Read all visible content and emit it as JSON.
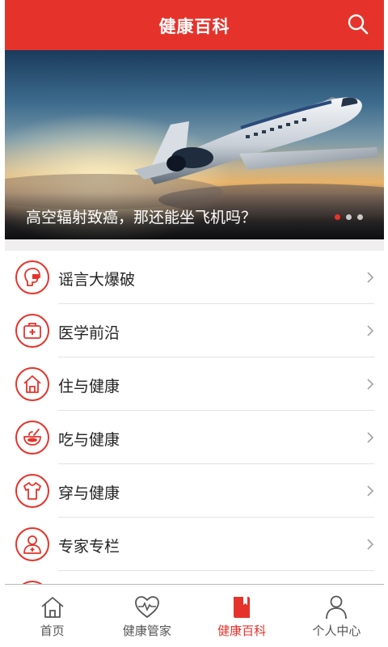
{
  "header": {
    "title": "健康百科",
    "search_icon": "search-icon"
  },
  "banner": {
    "caption": "高空辐射致癌，那还能坐飞机吗？",
    "slide_count": 3,
    "active_slide": 1
  },
  "categories": [
    {
      "label": "谣言大爆破",
      "icon": "rumor-speaker-icon"
    },
    {
      "label": "医学前沿",
      "icon": "medical-kit-icon"
    },
    {
      "label": "住与健康",
      "icon": "house-icon"
    },
    {
      "label": "吃与健康",
      "icon": "bowl-icon"
    },
    {
      "label": "穿与健康",
      "icon": "shirt-icon"
    },
    {
      "label": "专家专栏",
      "icon": "doctor-icon"
    }
  ],
  "tabbar": {
    "tabs": [
      {
        "label": "首页",
        "icon": "home-icon",
        "active": false
      },
      {
        "label": "健康管家",
        "icon": "heartbeat-icon",
        "active": false
      },
      {
        "label": "健康百科",
        "icon": "book-icon",
        "active": true
      },
      {
        "label": "个人中心",
        "icon": "person-icon",
        "active": false
      }
    ]
  },
  "colors": {
    "accent": "#e5332b",
    "divider": "#e3e3e3"
  }
}
